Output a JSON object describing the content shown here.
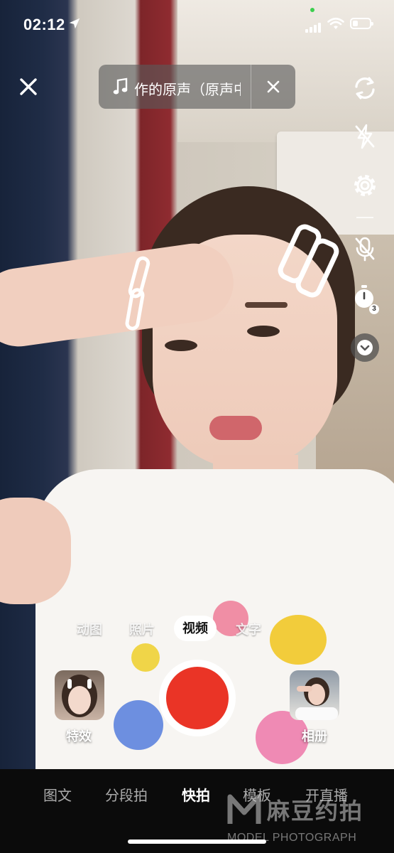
{
  "status_bar": {
    "time": "02:12",
    "location_icon": "location-arrow-icon",
    "signal_icon": "cellular-signal-icon",
    "wifi_icon": "wifi-icon",
    "battery_icon": "battery-icon"
  },
  "music": {
    "note_icon": "music-note-icon",
    "title": "作的原声（原声中",
    "remove_icon": "close-icon"
  },
  "close_icon": "close-icon",
  "right_toolbar": {
    "icons": [
      "flip-camera-icon",
      "flash-off-icon",
      "settings-gear-icon",
      "mic-off-icon",
      "timer-icon",
      "chevron-down-icon"
    ],
    "timer_badge": "3"
  },
  "capture_modes": {
    "items": [
      "动图",
      "照片",
      "视频",
      "文字"
    ],
    "selected": "视频"
  },
  "effects": {
    "label": "特效"
  },
  "album": {
    "label": "相册"
  },
  "bottom_nav": {
    "items": [
      "图文",
      "分段拍",
      "快拍",
      "模板",
      "开直播"
    ],
    "active": "快拍"
  },
  "watermark": {
    "title": "麻豆约拍",
    "subtitle": "MODEL PHOTOGRAPH"
  },
  "colors": {
    "shutter": "#ea3426",
    "mode_active_bg": "#ffffff",
    "nav_bg": "#0b0b0b"
  }
}
